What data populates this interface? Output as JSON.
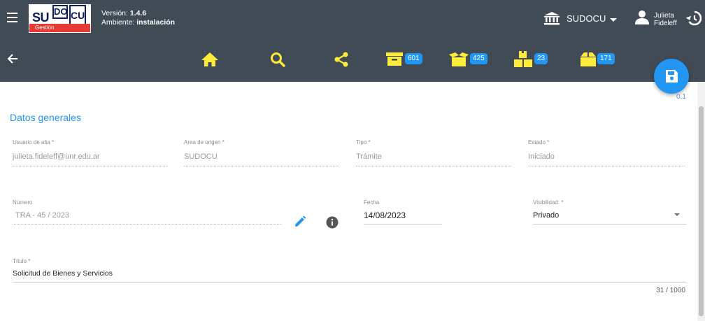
{
  "header": {
    "logo": {
      "su": "SU",
      "do": "DO",
      "cu": "CU",
      "gestion": "Gestión"
    },
    "version_label": "Versión:",
    "version_value": "1.4.6",
    "environment_label": "Ambiente:",
    "environment_value": "instalación",
    "institution": "SUDOCU",
    "user_first_name": "Julieta",
    "user_last_name": "Fideleff"
  },
  "toolbar": {
    "counts": {
      "inbox": "601",
      "open_box": "425",
      "boxes": "23",
      "archive": "171"
    }
  },
  "save": {
    "caption": "0.1"
  },
  "form": {
    "section_title": "Datos generales",
    "usuario_alta": {
      "label": "Usuario de alta *",
      "value": "julieta.fideleff@unr.edu.ar"
    },
    "area_origen": {
      "label": "Area de origen *",
      "value": "SUDOCU"
    },
    "tipo": {
      "label": "Tipo *",
      "value": "Trámite"
    },
    "estado": {
      "label": "Estado *",
      "value": "Iniciado"
    },
    "numero": {
      "label": "Número",
      "value": "TRA - 45 / 2023"
    },
    "fecha": {
      "label": "Fecha",
      "value": "14/08/2023"
    },
    "visibilidad": {
      "label": "Visibilidad: *",
      "value": "Privado"
    },
    "titulo": {
      "label": "Título *",
      "value": "Solicitud de Bienes y Servicios",
      "counter": "31 / 1000"
    }
  },
  "colors": {
    "bar": "#414b55",
    "accent_yellow": "#ffeb3b",
    "accent_blue": "#2196f3",
    "logo_red": "#e53935"
  },
  "icons": {
    "menu": "menu-icon",
    "bank": "bank-icon",
    "user": "user-icon",
    "history": "history-icon",
    "back": "arrow-left-icon",
    "home": "home-icon",
    "search": "search-icon",
    "share": "share-icon",
    "inbox": "inbox-icon",
    "open_box": "open-box-icon",
    "boxes": "boxes-icon",
    "archive": "archive-icon",
    "save": "floppy-icon",
    "edit": "pencil-icon",
    "info": "info-icon"
  }
}
